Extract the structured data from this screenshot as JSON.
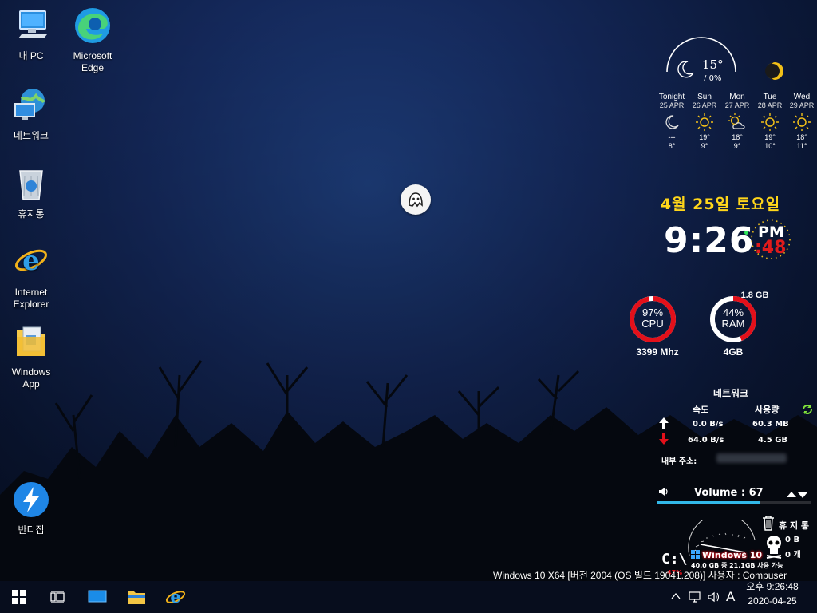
{
  "desktop": {
    "icons": [
      {
        "label": "내 PC"
      },
      {
        "label": "Microsoft\nEdge"
      },
      {
        "label": "네트워크"
      },
      {
        "label": "휴지통"
      },
      {
        "label": "Internet\nExplorer"
      },
      {
        "label": "Windows\nApp"
      },
      {
        "label": "반디집"
      }
    ]
  },
  "weather": {
    "current_temp": "15°",
    "current_precip": "0%",
    "forecast": [
      {
        "day": "Tonight",
        "date": "25 APR",
        "hi": "---",
        "lo": "8°",
        "icon": "moon-icon"
      },
      {
        "day": "Sun",
        "date": "26 APR",
        "hi": "19°",
        "lo": "9°",
        "icon": "sun-icon"
      },
      {
        "day": "Mon",
        "date": "27 APR",
        "hi": "18°",
        "lo": "9°",
        "icon": "partly-cloudy-icon"
      },
      {
        "day": "Tue",
        "date": "28 APR",
        "hi": "19°",
        "lo": "10°",
        "icon": "sun-icon"
      },
      {
        "day": "Wed",
        "date": "29 APR",
        "hi": "18°",
        "lo": "11°",
        "icon": "sun-icon"
      }
    ]
  },
  "clock": {
    "date": "4월 25일 토요일",
    "time": "9:26",
    "ampm": "PM",
    "seconds": ":48"
  },
  "system": {
    "cpu_percent": "97%",
    "cpu_label": "CPU",
    "cpu_freq": "3399 Mhz",
    "cpu_value": 97,
    "ram_used": "1.8 GB",
    "ram_percent": "44%",
    "ram_label": "RAM",
    "ram_total": "4GB",
    "ram_value": 44,
    "accent_color": "#e3101a"
  },
  "network": {
    "title": "네트워크",
    "speed_header": "속도",
    "usage_header": "사용량",
    "up_speed": "0.0 B/s",
    "up_usage": "60.3 MB",
    "down_speed": "64.0 B/s",
    "down_usage": "4.5 GB",
    "internal_label": "내부 주소:"
  },
  "volume": {
    "label": "Volume : 67",
    "value": 67
  },
  "recycle": {
    "label": "휴 지 통",
    "size": "0 B",
    "count": "0 개"
  },
  "drive": {
    "os_label": "Windows 10",
    "usage": "40.0 GB 중 21.1GB 사용 가능",
    "percent": "47%"
  },
  "taskbar": {
    "build_text": "Windows 10 X64 [버전 2004 (OS 빌드 19041.208)] 사용자 : Compuser",
    "ime": "A",
    "time": "오후 9:26:48",
    "date": "2020-04-25"
  }
}
